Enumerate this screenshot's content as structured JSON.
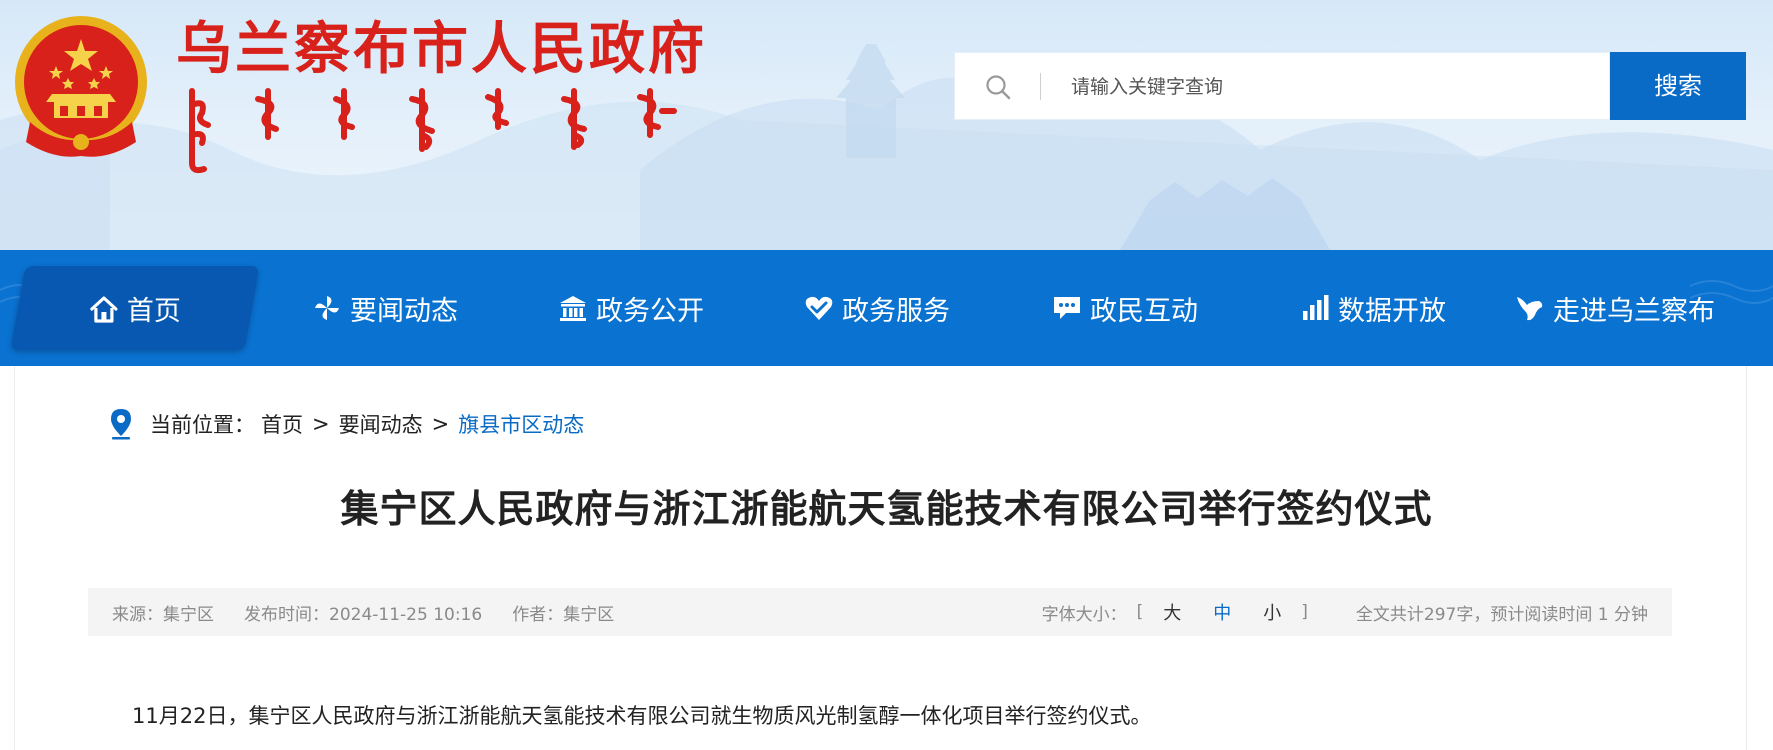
{
  "header": {
    "site_title": "乌兰察布市人民政府",
    "mongolian_title": "ᠤᠯᠠᠭᠠᠨᠴᠠᠪ ᠬᠣᠲᠠ ᠶᠢᠨ ᠠᠷᠠᠳ ᠤᠨ ᠵᠠᠰᠠᠭ ᠤᠨ ᠭᠠᠵᠠᠷ",
    "search": {
      "placeholder": "请输入关键字查询",
      "value": "",
      "button_label": "搜索"
    }
  },
  "nav": {
    "items": [
      {
        "label": "首页",
        "icon": "home-icon",
        "active": true
      },
      {
        "label": "要闻动态",
        "icon": "pinwheel-icon",
        "active": false
      },
      {
        "label": "政务公开",
        "icon": "government-building-icon",
        "active": false
      },
      {
        "label": "政务服务",
        "icon": "heart-check-icon",
        "active": false
      },
      {
        "label": "政民互动",
        "icon": "chat-bubble-icon",
        "active": false
      },
      {
        "label": "数据开放",
        "icon": "bar-chart-icon",
        "active": false
      },
      {
        "label": "走进乌兰察布",
        "icon": "bird-icon",
        "active": false
      }
    ]
  },
  "breadcrumb": {
    "label": "当前位置：",
    "items": [
      "首页",
      "要闻动态"
    ],
    "separator": ">",
    "current": "旗县市区动态"
  },
  "article": {
    "title": "集宁区人民政府与浙江浙能航天氢能技术有限公司举行签约仪式",
    "meta": {
      "source": "来源：集宁区",
      "published": "发布时间：2024-11-25 10:16",
      "author": "作者：集宁区",
      "font_size_label": "字体大小：",
      "bracket_open": "[",
      "bracket_close": "]",
      "font_sizes": [
        "大",
        "中",
        "小"
      ],
      "reading_info": "全文共计297字，预计阅读时间 1 分钟"
    },
    "body": "11月22日，集宁区人民政府与浙江浙能航天氢能技术有限公司就生物质风光制氢醇一体化项目举行签约仪式。"
  },
  "colors": {
    "brand_red": "#d7211a",
    "nav_blue": "#0a72d1",
    "nav_active": "#0858b2",
    "link_blue": "#0a6bc6",
    "meta_bg": "#f4f4f4"
  }
}
